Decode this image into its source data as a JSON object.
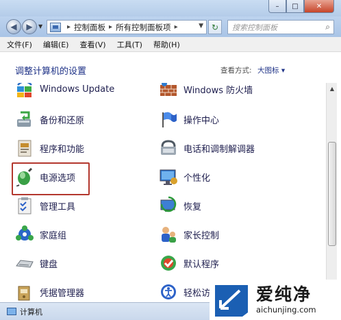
{
  "window": {
    "controls": {
      "minimize": "–",
      "maximize": "□",
      "close": "✕"
    }
  },
  "nav": {
    "breadcrumbs": [
      "控制面板",
      "所有控制面板项"
    ],
    "search_placeholder": "搜索控制面板"
  },
  "menu": {
    "items": [
      "文件(F)",
      "编辑(E)",
      "查看(V)",
      "工具(T)",
      "帮助(H)"
    ]
  },
  "header": {
    "title": "调整计算机的设置",
    "view_by_label": "查看方式:",
    "view_by_value": "大图标 ▾"
  },
  "items": [
    {
      "label": "Windows Update",
      "icon": "windows-update-icon"
    },
    {
      "label": "Windows 防火墙",
      "icon": "firewall-icon"
    },
    {
      "label": "备份和还原",
      "icon": "backup-restore-icon"
    },
    {
      "label": "操作中心",
      "icon": "action-center-flag-icon"
    },
    {
      "label": "程序和功能",
      "icon": "programs-features-icon"
    },
    {
      "label": "电话和调制解调器",
      "icon": "phone-modem-icon"
    },
    {
      "label": "电源选项",
      "icon": "power-options-icon"
    },
    {
      "label": "个性化",
      "icon": "personalization-icon"
    },
    {
      "label": "管理工具",
      "icon": "admin-tools-icon"
    },
    {
      "label": "恢复",
      "icon": "recovery-icon"
    },
    {
      "label": "家庭组",
      "icon": "homegroup-icon"
    },
    {
      "label": "家长控制",
      "icon": "parental-controls-icon"
    },
    {
      "label": "键盘",
      "icon": "keyboard-icon"
    },
    {
      "label": "默认程序",
      "icon": "default-programs-icon"
    },
    {
      "label": "凭据管理器",
      "icon": "credential-manager-icon"
    },
    {
      "label": "轻松访",
      "icon": "ease-of-access-icon"
    }
  ],
  "status": {
    "text": "计算机"
  },
  "watermark": {
    "big": "爱纯净",
    "small": "aichunjing.com"
  },
  "colors": {
    "link": "#1e3287",
    "highlight": "#b3372d",
    "chrome": "#bdd3ee"
  }
}
